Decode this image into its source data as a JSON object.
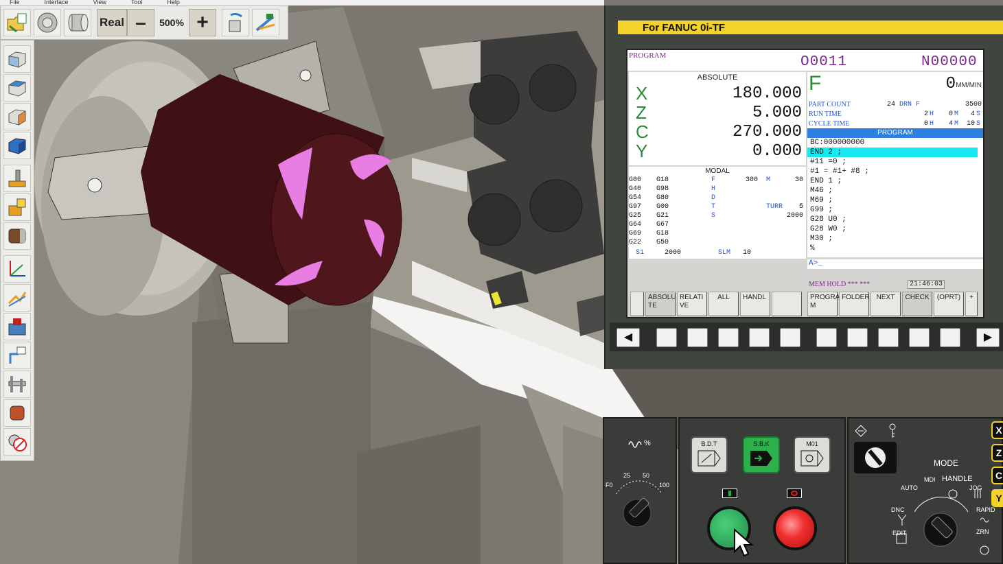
{
  "menubar": {
    "items": [
      "File",
      "Interface",
      "View",
      "Tool",
      "Help"
    ]
  },
  "toolbar": {
    "real_label": "Real",
    "zoom_out_label": "–",
    "zoom_value": "500%",
    "zoom_in_label": "+",
    "icons": [
      "open-project-icon",
      "chuck-icon",
      "workpiece-icon",
      "measure-icon",
      "tool-path-icon"
    ]
  },
  "left_toolbar": {
    "icons": [
      "view-front-icon",
      "view-top-icon",
      "view-side-icon",
      "view-iso-icon",
      "tool-setting-icon",
      "workpiece-setting-icon",
      "material-icon",
      "coordinate-icon",
      "tool-path-icon",
      "machine-icon",
      "offset-icon",
      "caliper-icon",
      "stock-icon",
      "collision-icon"
    ]
  },
  "cnc": {
    "title": "For FANUC 0i-TF",
    "mode": "PROGRAM",
    "program_no": "O0011",
    "sequence_no": "N00000",
    "absolute_title": "ABSOLUTE",
    "axes": [
      {
        "name": "X",
        "value": "180.000"
      },
      {
        "name": "Z",
        "value": "5.000"
      },
      {
        "name": "C",
        "value": "270.000"
      },
      {
        "name": "Y",
        "value": "0.000"
      }
    ],
    "feed": {
      "label": "F",
      "value": "0",
      "unit": "MM/MIN"
    },
    "counters": {
      "part_count_label": "PART COUNT",
      "part_count": "24",
      "drn_label": "DRN F",
      "drn_value": "3500",
      "run_label": "RUN TIME",
      "run_h": "2",
      "run_m": "0",
      "run_s": "4",
      "cycle_label": "CYCLE TIME",
      "cycle_h": "0",
      "cycle_m": "4",
      "cycle_s": "10",
      "h_unit": "H",
      "m_unit": "M",
      "s_unit": "S"
    },
    "program_header": "PROGRAM",
    "program_lines": [
      {
        "text": "BC:000000000",
        "type": "bc"
      },
      {
        "text": "END 2 ;",
        "type": "hl"
      },
      {
        "text": "#11 =0 ;",
        "type": ""
      },
      {
        "text": "#1 = #1+ #8 ;",
        "type": ""
      },
      {
        "text": "END 1 ;",
        "type": ""
      },
      {
        "text": "M46 ;",
        "type": ""
      },
      {
        "text": "M69 ;",
        "type": ""
      },
      {
        "text": "G99 ;",
        "type": ""
      },
      {
        "text": "G28 U0 ;",
        "type": ""
      },
      {
        "text": "G28 W0 ;",
        "type": ""
      },
      {
        "text": "M30 ;",
        "type": ""
      },
      {
        "text": "%",
        "type": ""
      }
    ],
    "modal": {
      "title": "MODAL",
      "codes": [
        [
          "G00",
          "G18"
        ],
        [
          "G40",
          "G98"
        ],
        [
          "G54",
          "G80"
        ],
        [
          "G97",
          "G00"
        ],
        [
          "G25",
          "G21"
        ],
        [
          "G64",
          "G67"
        ],
        [
          "G69",
          "G18"
        ],
        [
          "G22",
          "G50"
        ]
      ],
      "f_label": "F",
      "f_value": "300",
      "m_label": "M",
      "m_value": "30",
      "h_label": "H",
      "d_label": "D",
      "t_label": "T",
      "turr_label": "TURR",
      "t_value": "5",
      "s_label": "S",
      "s_value": "2000",
      "s1_label": "S1",
      "s1_value": "2000",
      "slm_label": "SLM",
      "slm_value": "10"
    },
    "input_prompt": "A>_",
    "status": "MEM HOLD *** ***",
    "time": "21:46:03",
    "softkeys": [
      "",
      "ABSOLU TE",
      "RELATI VE",
      "ALL",
      "HANDL",
      "",
      "PROGRA M",
      "FOLDER",
      "NEXT",
      "CHECK",
      "(OPRT)",
      "+"
    ]
  },
  "operator": {
    "override_label": "%",
    "override_scale": [
      "F0",
      "25",
      "50",
      "100"
    ],
    "buttons": [
      "B.D.T",
      "S.B.K",
      "M01"
    ],
    "mode_label": "MODE",
    "mode_positions": [
      "AUTO",
      "MDI",
      "HANDLE",
      "JOG",
      "RAPID",
      "ZRN",
      "EDIT",
      "DNC"
    ],
    "axis_select": [
      "X",
      "Z",
      "C",
      "Y"
    ],
    "axis_active": "Y"
  },
  "colors": {
    "fanuc_yellow": "#f4d22a",
    "workpiece": "#4a1418",
    "cut_faces": "#e87ee4",
    "program_highlight": "#16e9ef",
    "axis_green": "#2a8a3a"
  }
}
